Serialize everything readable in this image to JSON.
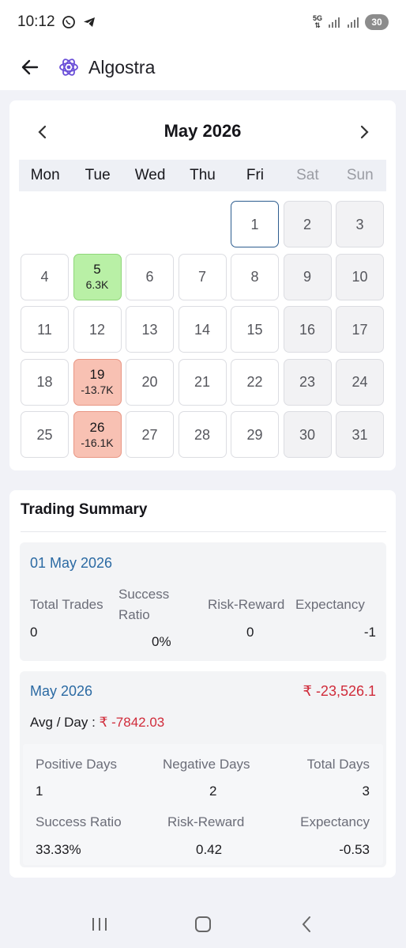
{
  "status_bar": {
    "time": "10:12",
    "network": "5G",
    "battery": "30"
  },
  "header": {
    "title": "Algostra"
  },
  "calendar": {
    "month_title": "May 2026",
    "weekdays": [
      "Mon",
      "Tue",
      "Wed",
      "Thu",
      "Fri",
      "Sat",
      "Sun"
    ],
    "colors": {
      "profit": "#b9f0a6",
      "loss": "#f8c1b3",
      "today_border": "#2d5d8f"
    },
    "days": [
      {
        "num": "",
        "pnl": "",
        "status": "blank"
      },
      {
        "num": "",
        "pnl": "",
        "status": "blank"
      },
      {
        "num": "",
        "pnl": "",
        "status": "blank"
      },
      {
        "num": "",
        "pnl": "",
        "status": "blank"
      },
      {
        "num": "1",
        "pnl": "",
        "status": "today"
      },
      {
        "num": "2",
        "pnl": "",
        "status": "weekend"
      },
      {
        "num": "3",
        "pnl": "",
        "status": "weekend"
      },
      {
        "num": "4",
        "pnl": "",
        "status": "normal"
      },
      {
        "num": "5",
        "pnl": "6.3K",
        "status": "profit"
      },
      {
        "num": "6",
        "pnl": "",
        "status": "normal"
      },
      {
        "num": "7",
        "pnl": "",
        "status": "normal"
      },
      {
        "num": "8",
        "pnl": "",
        "status": "normal"
      },
      {
        "num": "9",
        "pnl": "",
        "status": "weekend"
      },
      {
        "num": "10",
        "pnl": "",
        "status": "weekend"
      },
      {
        "num": "11",
        "pnl": "",
        "status": "normal"
      },
      {
        "num": "12",
        "pnl": "",
        "status": "normal"
      },
      {
        "num": "13",
        "pnl": "",
        "status": "normal"
      },
      {
        "num": "14",
        "pnl": "",
        "status": "normal"
      },
      {
        "num": "15",
        "pnl": "",
        "status": "normal"
      },
      {
        "num": "16",
        "pnl": "",
        "status": "weekend"
      },
      {
        "num": "17",
        "pnl": "",
        "status": "weekend"
      },
      {
        "num": "18",
        "pnl": "",
        "status": "normal"
      },
      {
        "num": "19",
        "pnl": "-13.7K",
        "status": "loss"
      },
      {
        "num": "20",
        "pnl": "",
        "status": "normal"
      },
      {
        "num": "21",
        "pnl": "",
        "status": "normal"
      },
      {
        "num": "22",
        "pnl": "",
        "status": "normal"
      },
      {
        "num": "23",
        "pnl": "",
        "status": "weekend"
      },
      {
        "num": "24",
        "pnl": "",
        "status": "weekend"
      },
      {
        "num": "25",
        "pnl": "",
        "status": "normal"
      },
      {
        "num": "26",
        "pnl": "-16.1K",
        "status": "loss"
      },
      {
        "num": "27",
        "pnl": "",
        "status": "normal"
      },
      {
        "num": "28",
        "pnl": "",
        "status": "normal"
      },
      {
        "num": "29",
        "pnl": "",
        "status": "normal"
      },
      {
        "num": "30",
        "pnl": "",
        "status": "weekend"
      },
      {
        "num": "31",
        "pnl": "",
        "status": "weekend"
      }
    ]
  },
  "summary": {
    "title": "Trading Summary",
    "day": {
      "date": "01 May 2026",
      "total_trades_label": "Total Trades",
      "total_trades": "0",
      "success_ratio_label_1": "Success",
      "success_ratio_label_2": "Ratio",
      "success_ratio": "0%",
      "risk_reward_label": "Risk-Reward",
      "risk_reward": "0",
      "expectancy_label": "Expectancy",
      "expectancy": "-1"
    },
    "month": {
      "title": "May 2026",
      "total": "₹ -23,526.1",
      "avg_label": "Avg / Day :",
      "avg_value": "₹ -7842.03",
      "positive_days_label": "Positive Days",
      "positive_days": "1",
      "negative_days_label": "Negative Days",
      "negative_days": "2",
      "total_days_label": "Total Days",
      "total_days": "3",
      "success_ratio_label": "Success Ratio",
      "success_ratio": "33.33%",
      "risk_reward_label": "Risk-Reward",
      "risk_reward": "0.42",
      "expectancy_label": "Expectancy",
      "expectancy": "-0.53"
    }
  },
  "nav_bar": {
    "icons": [
      "recent-apps-icon",
      "home-icon",
      "back-icon"
    ]
  }
}
